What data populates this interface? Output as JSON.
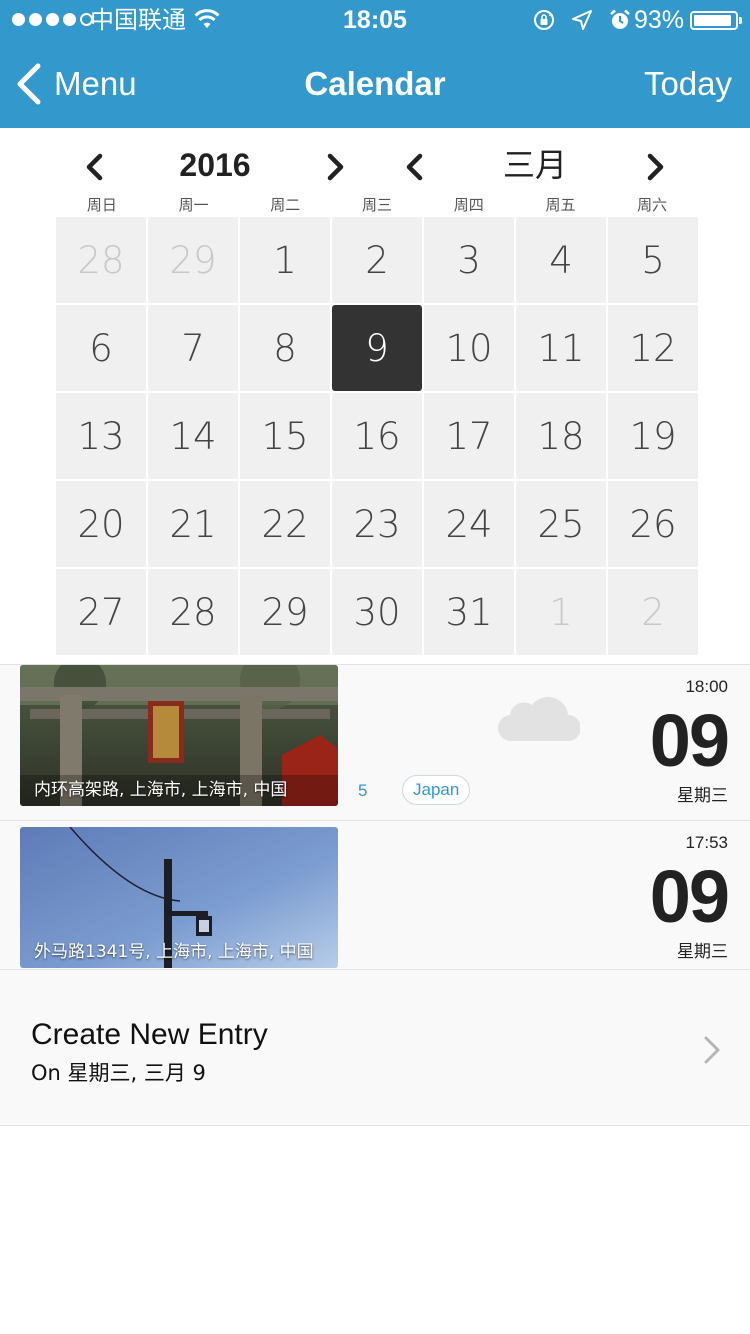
{
  "status_bar": {
    "carrier": "中国联通",
    "time": "18:05",
    "battery_percent": "93%",
    "battery_level": 0.93,
    "signal_bars": 4,
    "icons": [
      "wifi-icon",
      "rotation-lock-icon",
      "location-arrow-icon",
      "alarm-icon",
      "battery-icon"
    ]
  },
  "nav": {
    "back_label": "Menu",
    "title": "Calendar",
    "right_label": "Today",
    "background": "#3399cc"
  },
  "calendar": {
    "year": "2016",
    "month": "三月",
    "weekdays": [
      "周日",
      "周一",
      "周二",
      "周三",
      "周四",
      "周五",
      "周六"
    ],
    "days": [
      {
        "label": "28",
        "state": "other"
      },
      {
        "label": "29",
        "state": "other"
      },
      {
        "label": "1",
        "state": ""
      },
      {
        "label": "2",
        "state": ""
      },
      {
        "label": "3",
        "state": ""
      },
      {
        "label": "4",
        "state": ""
      },
      {
        "label": "5",
        "state": ""
      },
      {
        "label": "6",
        "state": ""
      },
      {
        "label": "7",
        "state": ""
      },
      {
        "label": "8",
        "state": ""
      },
      {
        "label": "9",
        "state": "selected"
      },
      {
        "label": "10",
        "state": ""
      },
      {
        "label": "11",
        "state": ""
      },
      {
        "label": "12",
        "state": ""
      },
      {
        "label": "13",
        "state": ""
      },
      {
        "label": "14",
        "state": ""
      },
      {
        "label": "15",
        "state": ""
      },
      {
        "label": "16",
        "state": ""
      },
      {
        "label": "17",
        "state": ""
      },
      {
        "label": "18",
        "state": ""
      },
      {
        "label": "19",
        "state": ""
      },
      {
        "label": "20",
        "state": ""
      },
      {
        "label": "21",
        "state": ""
      },
      {
        "label": "22",
        "state": ""
      },
      {
        "label": "23",
        "state": ""
      },
      {
        "label": "24",
        "state": ""
      },
      {
        "label": "25",
        "state": ""
      },
      {
        "label": "26",
        "state": ""
      },
      {
        "label": "27",
        "state": ""
      },
      {
        "label": "28",
        "state": ""
      },
      {
        "label": "29",
        "state": ""
      },
      {
        "label": "30",
        "state": ""
      },
      {
        "label": "31",
        "state": ""
      },
      {
        "label": "1",
        "state": "other"
      },
      {
        "label": "2",
        "state": "other"
      }
    ]
  },
  "entries": [
    {
      "location": "内环高架路, 上海市, 上海市, 中国",
      "time": "18:00",
      "day": "09",
      "weekday": "星期三",
      "count": "5",
      "tag": "Japan",
      "weather_icon": "cloud-icon"
    },
    {
      "location": "外马路1341号, 上海市, 上海市, 中国",
      "time": "17:53",
      "day": "09",
      "weekday": "星期三"
    }
  ],
  "create_entry": {
    "title": "Create New Entry",
    "subtitle": "On 星期三, 三月 9"
  }
}
